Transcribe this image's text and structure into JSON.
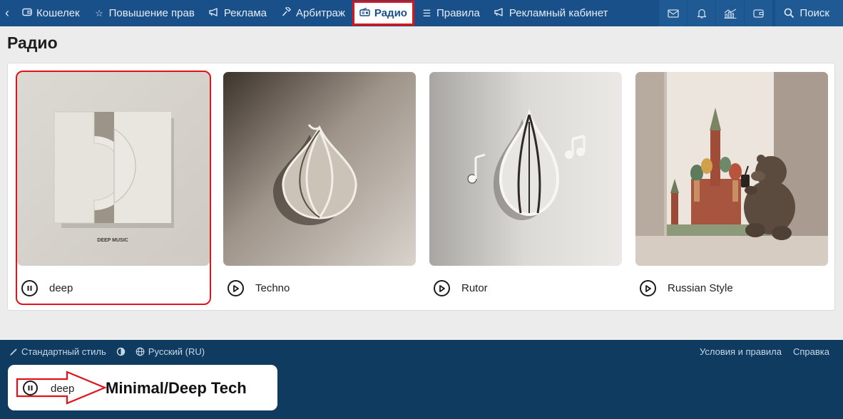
{
  "nav": {
    "items": [
      {
        "label": "Кошелек",
        "icon": "wallet-icon"
      },
      {
        "label": "Повышение прав",
        "icon": "star-icon"
      },
      {
        "label": "Реклама",
        "icon": "megaphone-icon"
      },
      {
        "label": "Арбитраж",
        "icon": "gavel-icon"
      },
      {
        "label": "Радио",
        "icon": "radio-icon"
      },
      {
        "label": "Правила",
        "icon": "list-icon"
      },
      {
        "label": "Рекламный кабинет",
        "icon": "megaphone-icon"
      }
    ],
    "active_label": "Радио",
    "search_label": "Поиск",
    "right_icons": [
      "mail-icon",
      "bell-icon",
      "chart-icon",
      "wallet-icon"
    ]
  },
  "page": {
    "title": "Радио"
  },
  "stations": [
    {
      "name": "deep",
      "state": "playing",
      "cover_text": "DEEP MUSIC"
    },
    {
      "name": "Techno",
      "state": "stopped"
    },
    {
      "name": "Rutor",
      "state": "stopped"
    },
    {
      "name": "Russian Style",
      "state": "stopped"
    }
  ],
  "footer": {
    "style_label": "Стандартный стиль",
    "language_label": "Русский (RU)",
    "terms_label": "Условия и правила",
    "help_label": "Справка"
  },
  "player": {
    "station": "deep",
    "genre": "Minimal/Deep Tech",
    "state": "playing"
  },
  "colors": {
    "nav_bg": "#19508a",
    "footer_bg": "#0e3b5f",
    "highlight": "#e0121a"
  }
}
